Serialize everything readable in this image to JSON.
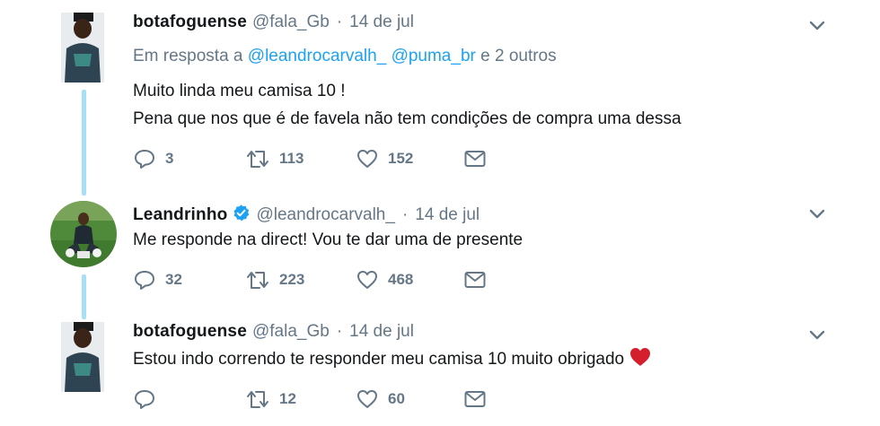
{
  "tweets": [
    {
      "display_name": "botafoguense",
      "verified": false,
      "handle": "@fala_Gb",
      "date": "14 de jul",
      "reply_prefix": "Em resposta a",
      "reply_mentions": [
        "@leandrocarvalh_",
        "@puma_br"
      ],
      "reply_suffix": "e 2 outros",
      "lines": [
        "Muito linda meu camisa 10 !",
        "Pena  que nos que é de favela não tem condições de compra uma dessa"
      ],
      "replies": "3",
      "retweets": "113",
      "likes": "152"
    },
    {
      "display_name": "Leandrinho",
      "verified": true,
      "handle": "@leandrocarvalh_",
      "date": "14 de jul",
      "lines": [
        "Me responde na direct! Vou te dar uma de presente"
      ],
      "replies": "32",
      "retweets": "223",
      "likes": "468"
    },
    {
      "display_name": "botafoguense",
      "verified": false,
      "handle": "@fala_Gb",
      "date": "14 de jul",
      "lines": [
        "Estou indo correndo te responder meu camisa 10 muito obrigado"
      ],
      "emoji": "red-heart",
      "replies": "",
      "retweets": "12",
      "likes": "60"
    }
  ],
  "separator_dot": "·",
  "colors": {
    "text": "#14171a",
    "secondary": "#657786",
    "link": "#1da1f2",
    "thread_line": "#a6e0f5",
    "heart_emoji": "#d4202c"
  },
  "icons": [
    "reply-icon",
    "retweet-icon",
    "like-icon",
    "direct-message-icon",
    "caret-down-icon",
    "verified-badge-icon"
  ]
}
